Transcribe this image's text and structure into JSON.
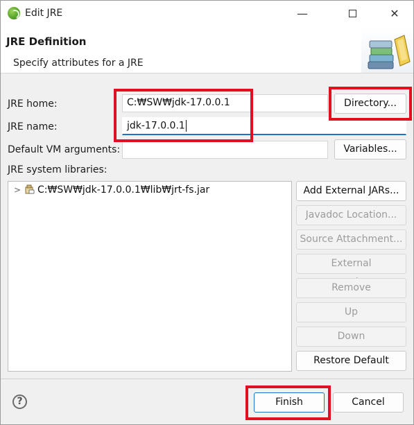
{
  "window": {
    "title": "Edit JRE",
    "close_glyph": "✕",
    "minimize_glyph": "—"
  },
  "header": {
    "title": "JRE Definition",
    "subtitle": "Specify attributes for a JRE"
  },
  "form": {
    "jre_home_label": "JRE home:",
    "jre_home_value": "C:₩SW₩jdk-17.0.0.1",
    "jre_name_label": "JRE name:",
    "jre_name_value": "jdk-17.0.0.1",
    "vm_args_label": "Default VM arguments:",
    "vm_args_value": "",
    "libraries_label": "JRE system libraries:"
  },
  "buttons": {
    "directory": "Directory...",
    "variables": "Variables...",
    "add_external_jars": "Add External JARs...",
    "javadoc_location": "Javadoc Location...",
    "source_attachment": "Source Attachment...",
    "external_annotations": "External annotations...",
    "remove": "Remove",
    "up": "Up",
    "down": "Down",
    "restore_default": "Restore Default",
    "finish": "Finish",
    "cancel": "Cancel"
  },
  "libraries": [
    {
      "path": "C:₩SW₩jdk-17.0.0.1₩lib₩jrt-fs.jar",
      "icon": "jar-icon"
    }
  ],
  "help": {
    "glyph": "?"
  },
  "colors": {
    "highlight": "#e0101e",
    "focus": "#1a73c8"
  }
}
